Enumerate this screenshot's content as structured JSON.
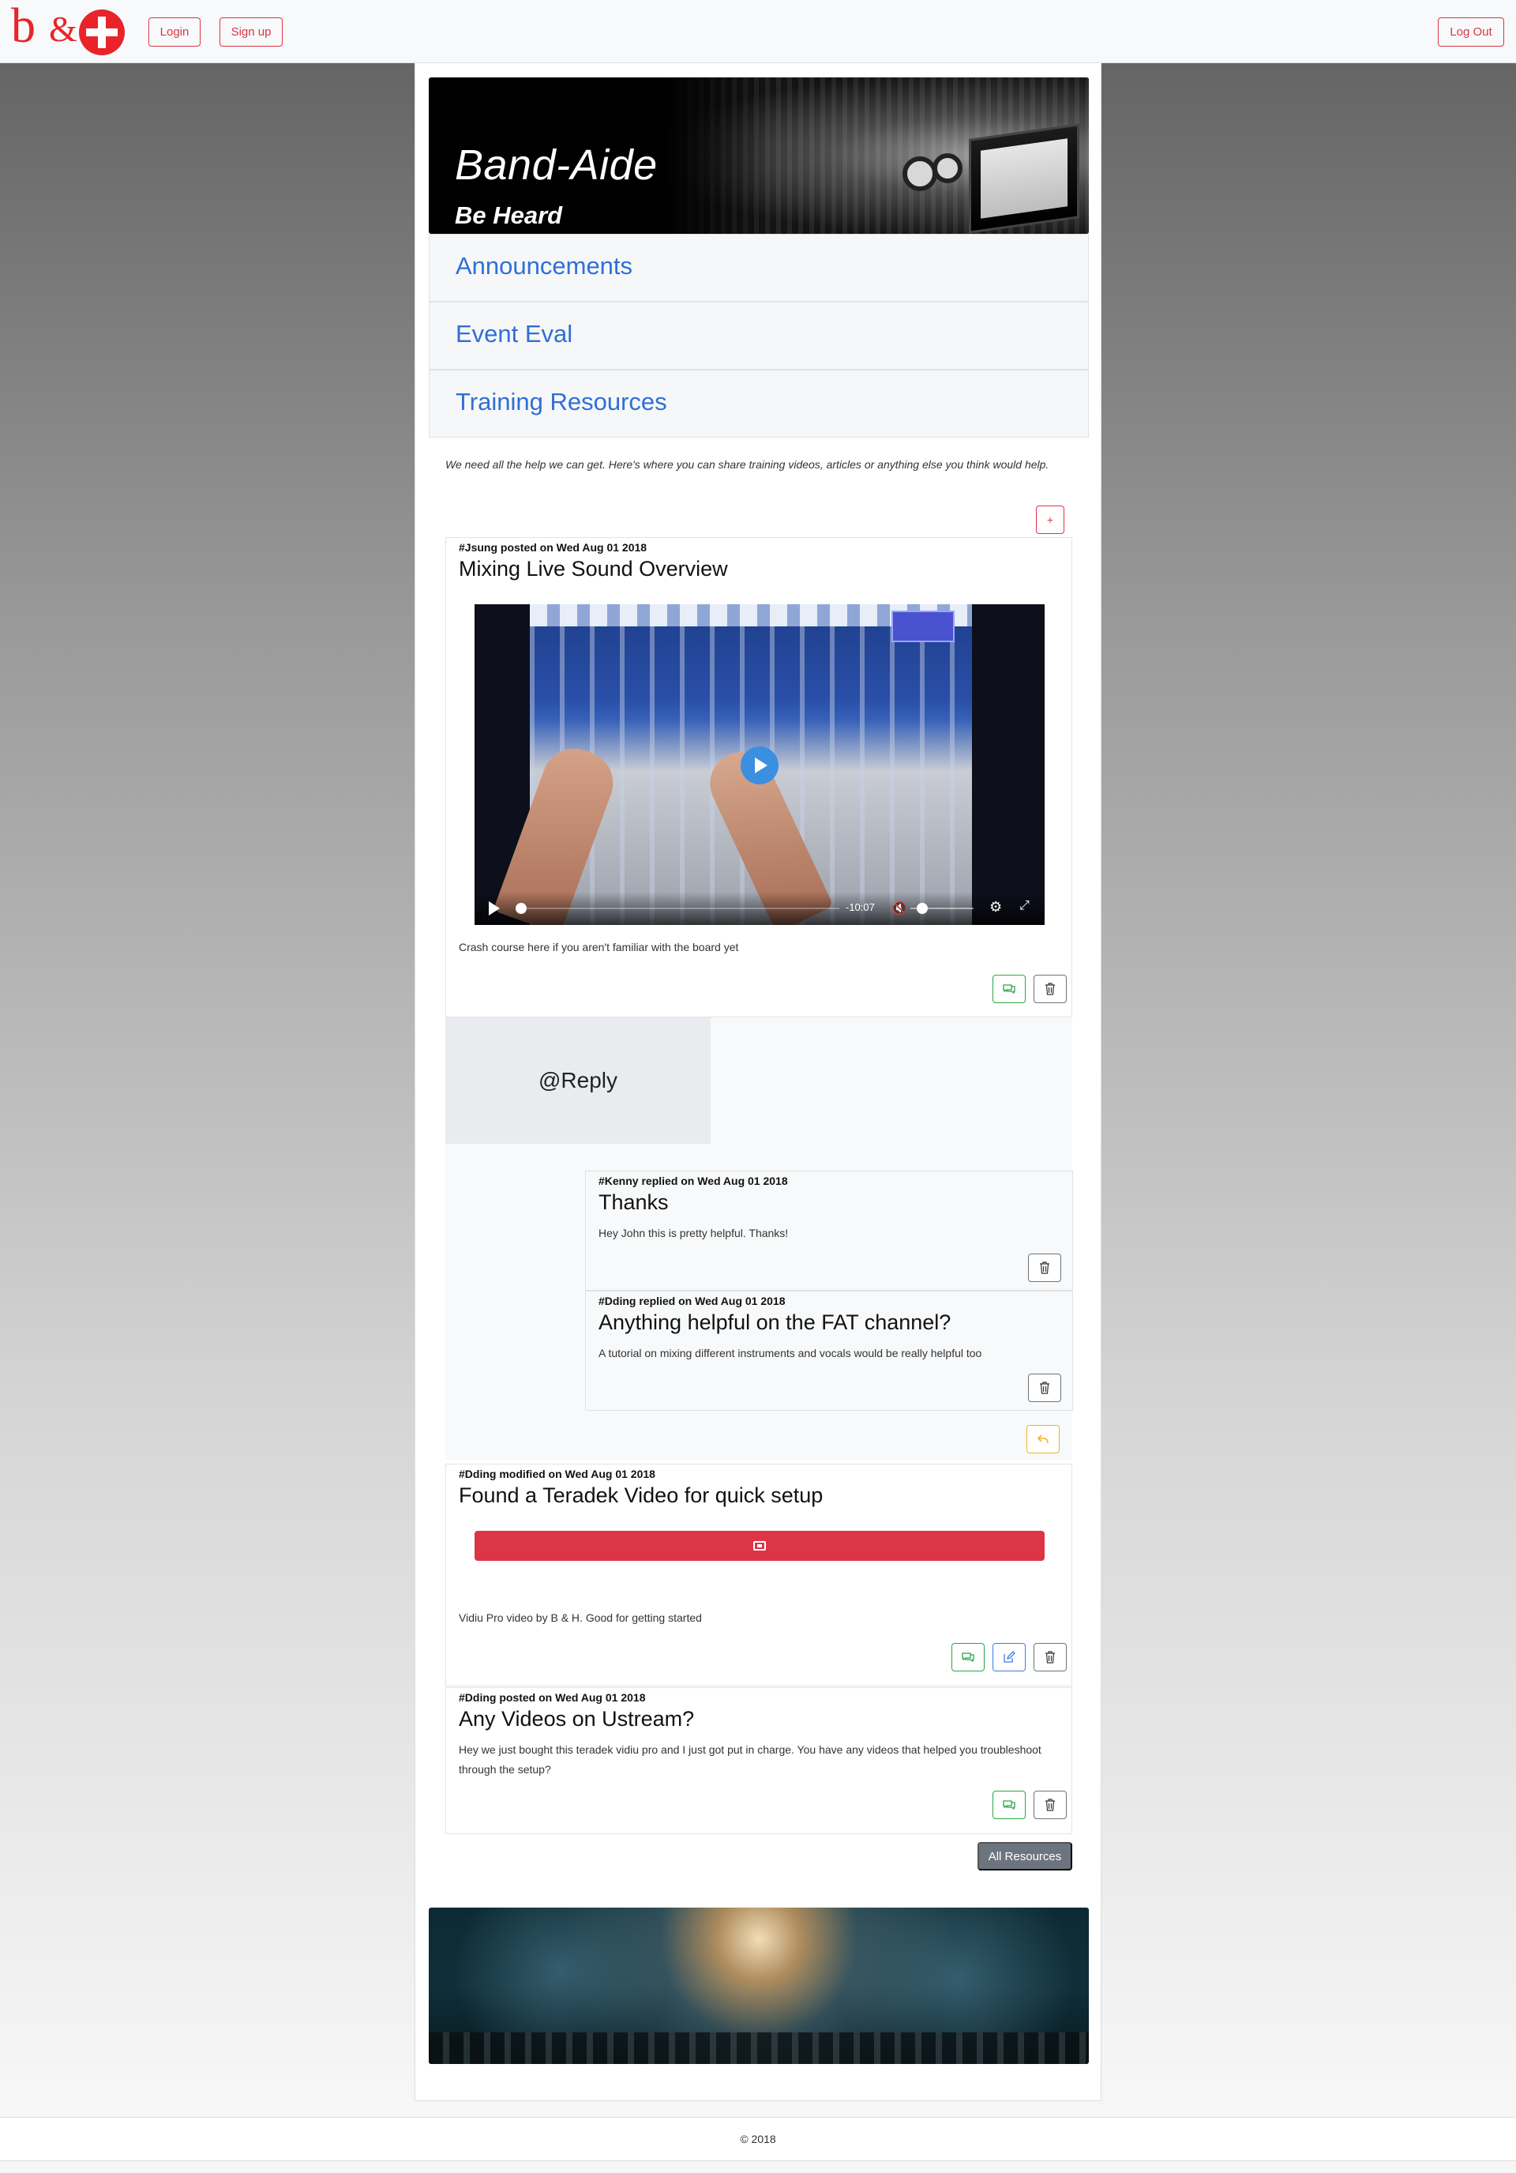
{
  "navbar": {
    "login_label": "Login",
    "signup_label": "Sign up",
    "logout_label": "Log Out"
  },
  "banner": {
    "title": "Band-Aide",
    "subtitle": "Be Heard"
  },
  "accordion": {
    "items": [
      "Announcements",
      "Event Eval",
      "Training Resources"
    ]
  },
  "training": {
    "intro": "We need all the help we can get. Here's where you can share training videos, articles or anything else you think would help.",
    "add_label": "+",
    "posts": [
      {
        "meta": "#Jsung posted on Wed Aug 01 2018",
        "title": "Mixing Live Sound Overview",
        "video_time": "-10:07",
        "text": "Crash course here if you aren't familiar with the board yet"
      },
      {
        "meta": "#Dding modified on Wed Aug 01 2018",
        "title": "Found a Teradek Video for quick setup",
        "text": "Vidiu Pro video by B & H. Good for getting started"
      },
      {
        "meta": "#Dding posted on Wed Aug 01 2018",
        "title": "Any Videos on Ustream?",
        "text": "Hey we just bought this teradek vidiu pro and I just got put in charge. You have any videos that helped you troubleshoot through the setup?"
      }
    ],
    "reply_label": "@Reply",
    "replies": [
      {
        "meta": "#Kenny replied on Wed Aug 01 2018",
        "title": "Thanks",
        "text": "Hey John this is pretty helpful. Thanks!"
      },
      {
        "meta": "#Dding replied on Wed Aug 01 2018",
        "title": "Anything helpful on the FAT channel?",
        "text": "A tutorial on mixing different instruments and vocals would be really helpful too"
      }
    ],
    "all_resources_label": "All Resources"
  },
  "footer": {
    "copyright": "© 2018"
  },
  "colors": {
    "brand_red": "#e8242a",
    "link_blue": "#2f6fd6",
    "danger": "#dc3545",
    "success": "#28a745",
    "secondary": "#6c757d",
    "warning": "#f0b429"
  },
  "icons": {
    "comment": "comments-icon",
    "delete": "trash-icon",
    "edit": "edit-icon",
    "reply": "reply-arrow-icon",
    "youtube": "youtube-icon"
  }
}
